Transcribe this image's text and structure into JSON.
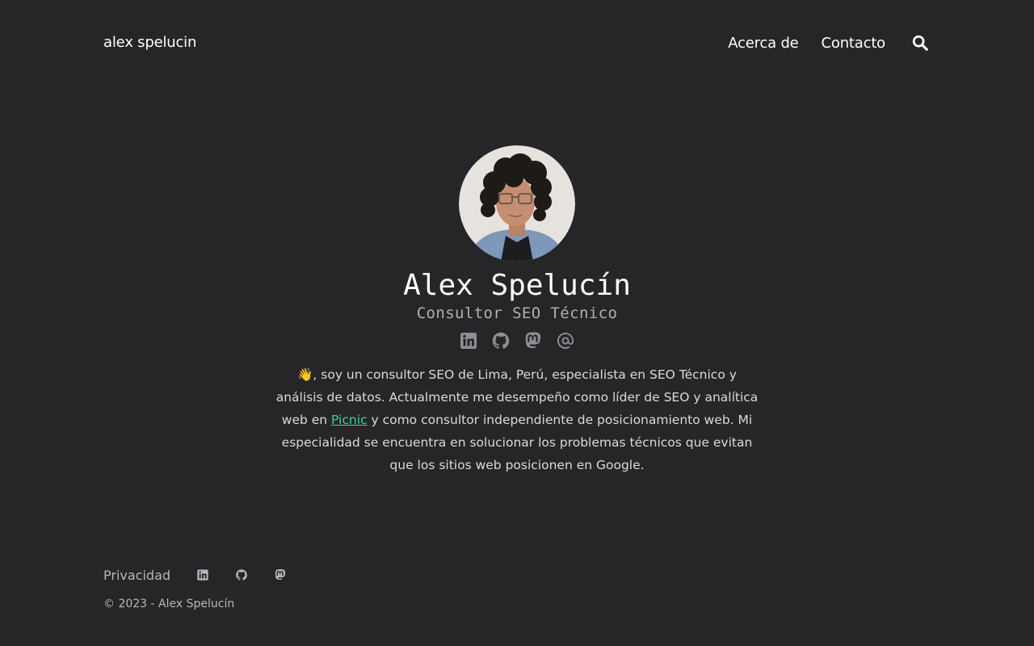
{
  "header": {
    "brand": "alex spelucin",
    "nav": [
      {
        "label": "Acerca de"
      },
      {
        "label": "Contacto"
      }
    ],
    "search_icon": "search-icon"
  },
  "profile": {
    "avatar_alt": "Alex Spelucín",
    "name": "Alex Spelucín",
    "subtitle": "Consultor SEO Técnico",
    "social_icons": [
      "linkedin-icon",
      "github-icon",
      "mastodon-icon",
      "at-email-icon"
    ],
    "bio": {
      "emoji": "👋",
      "before_link": ", soy un consultor SEO de Lima, Perú, especialista en SEO Técnico y análisis de datos. Actualmente me desempeño como líder de SEO y analítica web en ",
      "link_text": "Picnic",
      "after_link": " y como consultor independiente de posicionamiento web. Mi especialidad se encuentra en solucionar los problemas técnicos que evitan que los sitios web posicionen en Google."
    }
  },
  "footer": {
    "privacy": "Privacidad",
    "icons": [
      "linkedin-icon",
      "github-icon",
      "mastodon-icon"
    ],
    "copyright": "© 2023 - Alex Spelucín"
  },
  "colors": {
    "background": "#262629",
    "text": "#dadadb",
    "heading": "#ffffff",
    "muted": "#b0b0b4",
    "link_accent": "#35d39b",
    "icon": "#8e8e93"
  }
}
